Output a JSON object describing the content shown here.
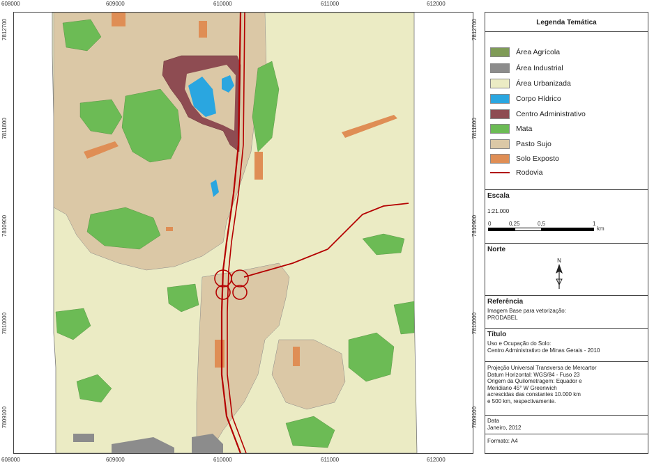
{
  "map": {
    "x_ticks": [
      "608000",
      "609000",
      "610000",
      "611000",
      "612000"
    ],
    "y_ticks": [
      "7812700",
      "7811800",
      "7810900",
      "7810000",
      "7809100"
    ],
    "colors": {
      "agricola": "#7f9b57",
      "industrial": "#8c8c8c",
      "urbanizada": "#ebebc4",
      "hidrico": "#2aa6e0",
      "administrativo": "#8e4c52",
      "mata": "#6cbb55",
      "pasto": "#dbc8a6",
      "solo": "#df8e55",
      "rodovia": "#b40000"
    }
  },
  "legend": {
    "title": "Legenda Temática",
    "items": [
      {
        "label": "Área Agrícola",
        "color": "#7f9b57"
      },
      {
        "label": "Área Industrial",
        "color": "#8c8c8c"
      },
      {
        "label": "Área Urbanizada",
        "color": "#ebebc4"
      },
      {
        "label": "Corpo Hídrico",
        "color": "#2aa6e0"
      },
      {
        "label": "Centro Administrativo",
        "color": "#8e4c52"
      },
      {
        "label": "Mata",
        "color": "#6cbb55"
      },
      {
        "label": "Pasto Sujo",
        "color": "#dbc8a6"
      },
      {
        "label": "Solo Exposto",
        "color": "#df8e55"
      }
    ],
    "road_label": "Rodovia",
    "road_color": "#b40000"
  },
  "scale": {
    "title": "Escala",
    "ratio": "1:21.000",
    "ticks": [
      "0",
      "0,25",
      "0,5",
      "1"
    ],
    "unit": "km"
  },
  "north": {
    "title": "Norte",
    "letter": "N"
  },
  "reference": {
    "title": "Referência",
    "line1": "Imagem Base para vetorização:",
    "line2": "PRODABEL"
  },
  "titulo": {
    "title": "Título",
    "line1": "Uso e Ocupação do Solo:",
    "line2": "Centro Administrativo de Minas Gerais - 2010"
  },
  "projection": {
    "lines": [
      "Projeção Universal Transversa de Mercartor",
      "Datum Horizontal: WGS/84 - Fuso 23",
      "Origem da Quilometragem: Equador e",
      "Meridiano 45° W Greenwich",
      "acrescidas das constantes 10.000 km",
      "e 500 km, respectivamente."
    ]
  },
  "date": {
    "title": "Data",
    "value": "Janeiro, 2012"
  },
  "format": {
    "text": "Formato: A4"
  }
}
